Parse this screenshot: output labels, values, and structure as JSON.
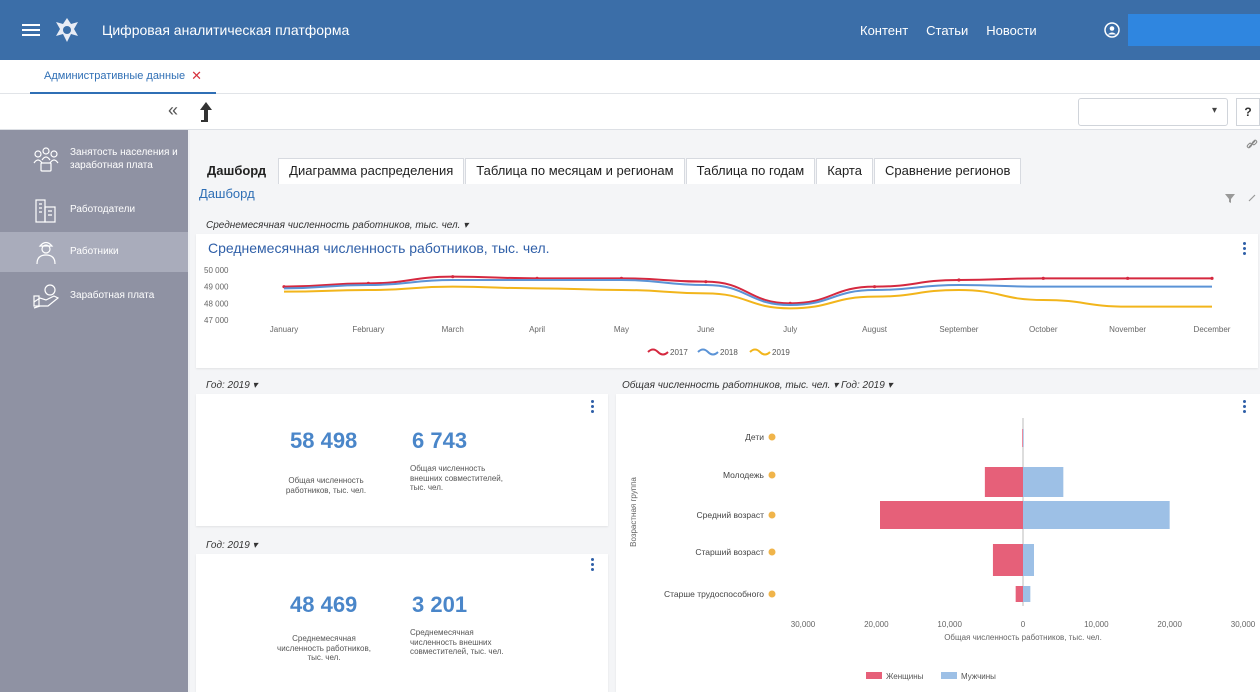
{
  "app": {
    "title": "Цифровая аналитическая платформа"
  },
  "nav": {
    "items": [
      "Контент",
      "Статьи",
      "Новости"
    ]
  },
  "document_tab": {
    "label": "Административные данные"
  },
  "toolbar": {
    "collapse_glyph": "«",
    "help_label": "?",
    "select_caret": "▾"
  },
  "sidebar": {
    "items": [
      {
        "label": "Занятость населения и заработная плата",
        "icon": "people-network-icon"
      },
      {
        "label": "Работодатели",
        "icon": "buildings-icon"
      },
      {
        "label": "Работники",
        "icon": "worker-icon",
        "active": true
      },
      {
        "label": "Заработная плата",
        "icon": "money-icon"
      }
    ]
  },
  "view_tabs": [
    "Дашборд",
    "Диаграмма распределения",
    "Таблица по месяцам и регионам",
    "Таблица по годам",
    "Карта",
    "Сравнение регионов"
  ],
  "dashboard_title": "Дашборд",
  "line_panel": {
    "selector": "Среднемесячная численность работников, тыс. чел. ▾",
    "title": "Среднемесячная численность работников, тыс. чел."
  },
  "kpi_panel_1": {
    "selector": "Год: 2019 ▾",
    "value_1": "58 498",
    "label_1": "Общая численность работников, тыс. чел.",
    "value_2": "6 743",
    "label_2": "Общая численность внешних совместителей, тыс. чел."
  },
  "kpi_panel_2": {
    "selector": "Год: 2019 ▾",
    "value_1": "48 469",
    "label_1": "Среднемесячная численность работников, тыс. чел.",
    "value_2": "3 201",
    "label_2": "Среднемесячная численность внешних совместителей, тыс. чел."
  },
  "bar_panel": {
    "selector": "Общая численность работников, тыс. чел. ▾  Год: 2019 ▾"
  },
  "colors": {
    "header": "#3b6ea8",
    "accent": "#2f6fb5",
    "series_2017": "#d5283f",
    "series_2018": "#5b93d6",
    "series_2019": "#f2b51b",
    "women": "#e66079",
    "men": "#9dc0e6"
  },
  "chart_data": [
    {
      "type": "line",
      "title": "",
      "categories": [
        "January",
        "February",
        "March",
        "April",
        "May",
        "June",
        "July",
        "August",
        "September",
        "October",
        "November",
        "December"
      ],
      "ylim": [
        47000,
        50000
      ],
      "yticks": [
        "50 000",
        "49 000",
        "48 000",
        "47 000"
      ],
      "series": [
        {
          "name": "2017",
          "values": [
            49000,
            49200,
            49600,
            49500,
            49500,
            49300,
            48000,
            49000,
            49400,
            49500,
            49500,
            49500
          ]
        },
        {
          "name": "2018",
          "values": [
            48900,
            49100,
            49400,
            49400,
            49400,
            49100,
            47900,
            48800,
            49100,
            49000,
            49000,
            49000
          ]
        },
        {
          "name": "2019",
          "values": [
            48700,
            48800,
            49000,
            48900,
            48800,
            48600,
            47700,
            48400,
            48800,
            48200,
            47800,
            47800
          ]
        }
      ],
      "legend": "bottom"
    },
    {
      "type": "bar",
      "orientation": "horizontal",
      "title": "",
      "xlabel": "Общая численность работников, тыс. чел.",
      "ylabel": "Возрастная группа",
      "categories": [
        "Дети",
        "Молодежь",
        "Средний возраст",
        "Старший возраст",
        "Старше трудоспособного"
      ],
      "xticks": [
        "30,000",
        "20,000",
        "10,000",
        "0",
        "10,000",
        "20,000",
        "30,000"
      ],
      "xlim": [
        -30000,
        30000
      ],
      "series": [
        {
          "name": "Женщины",
          "values": [
            -100,
            -5200,
            -19500,
            -4100,
            -1000
          ]
        },
        {
          "name": "Мужчины",
          "values": [
            100,
            5500,
            20000,
            1500,
            1000
          ]
        }
      ],
      "legend": "bottom"
    }
  ]
}
